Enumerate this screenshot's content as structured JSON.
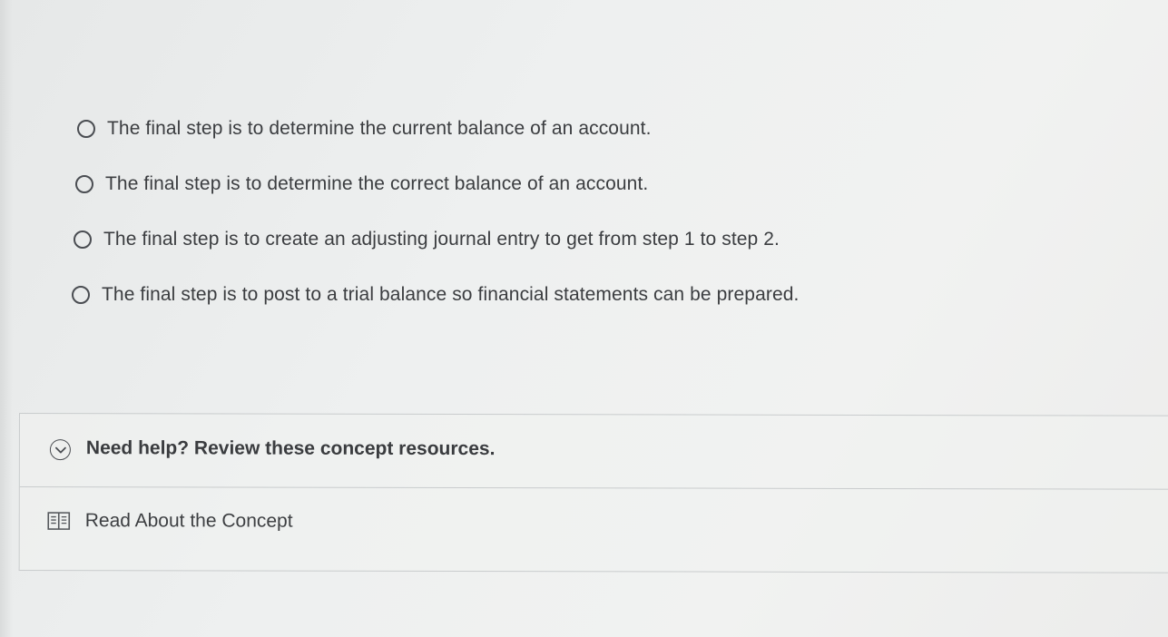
{
  "options": [
    {
      "label": "The final step is to determine the current balance of an account.",
      "selected": false
    },
    {
      "label": "The final step is to determine the correct balance of an account.",
      "selected": false
    },
    {
      "label": "The final step is to create an adjusting journal entry to get from step 1 to step 2.",
      "selected": false
    },
    {
      "label": "The final step is to post to a trial balance so financial statements can be prepared.",
      "selected": false
    }
  ],
  "help": {
    "title": "Need help? Review these concept resources.",
    "resource_label": "Read About the Concept",
    "expand_icon": "chevron-down-circle-icon",
    "resource_icon": "book-icon"
  },
  "colors": {
    "text": "#3b3d40",
    "border": "#c9cccd",
    "background": "#eef0f0"
  }
}
